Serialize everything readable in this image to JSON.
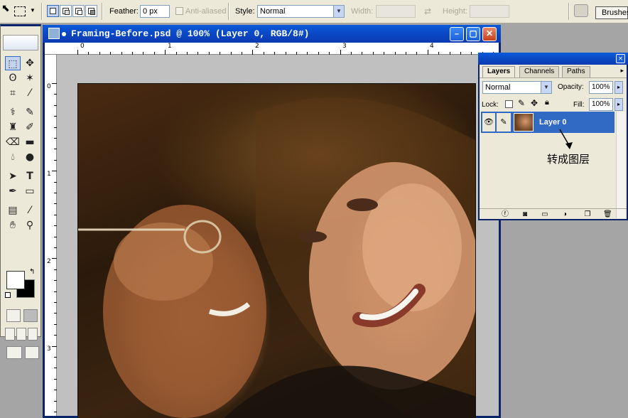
{
  "options_bar": {
    "feather_label": "Feather:",
    "feather_value": "0 px",
    "anti_aliased_label": "Anti-aliased",
    "style_label": "Style:",
    "style_value": "Normal",
    "width_label": "Width:",
    "height_label": "Height:",
    "brushes_label": "Brushes"
  },
  "document": {
    "title": "Framing-Before.psd @ 100% (Layer 0, RGB/8#)",
    "ruler_top": [
      "0",
      "1",
      "2",
      "3",
      "4"
    ],
    "ruler_left": [
      "0",
      "1",
      "2",
      "3"
    ]
  },
  "layers_panel": {
    "tabs": [
      "Layers",
      "Channels",
      "Paths"
    ],
    "active_tab": "Layers",
    "blend_mode": "Normal",
    "opacity_label": "Opacity:",
    "opacity_value": "100%",
    "lock_label": "Lock:",
    "fill_label": "Fill:",
    "fill_value": "100%",
    "layer_name": "Layer 0"
  },
  "annotation": "转成图层",
  "colors": {
    "title_bar": "#0a48c6",
    "selected_layer": "#316ac5",
    "panel_bg": "#ece9d8"
  }
}
